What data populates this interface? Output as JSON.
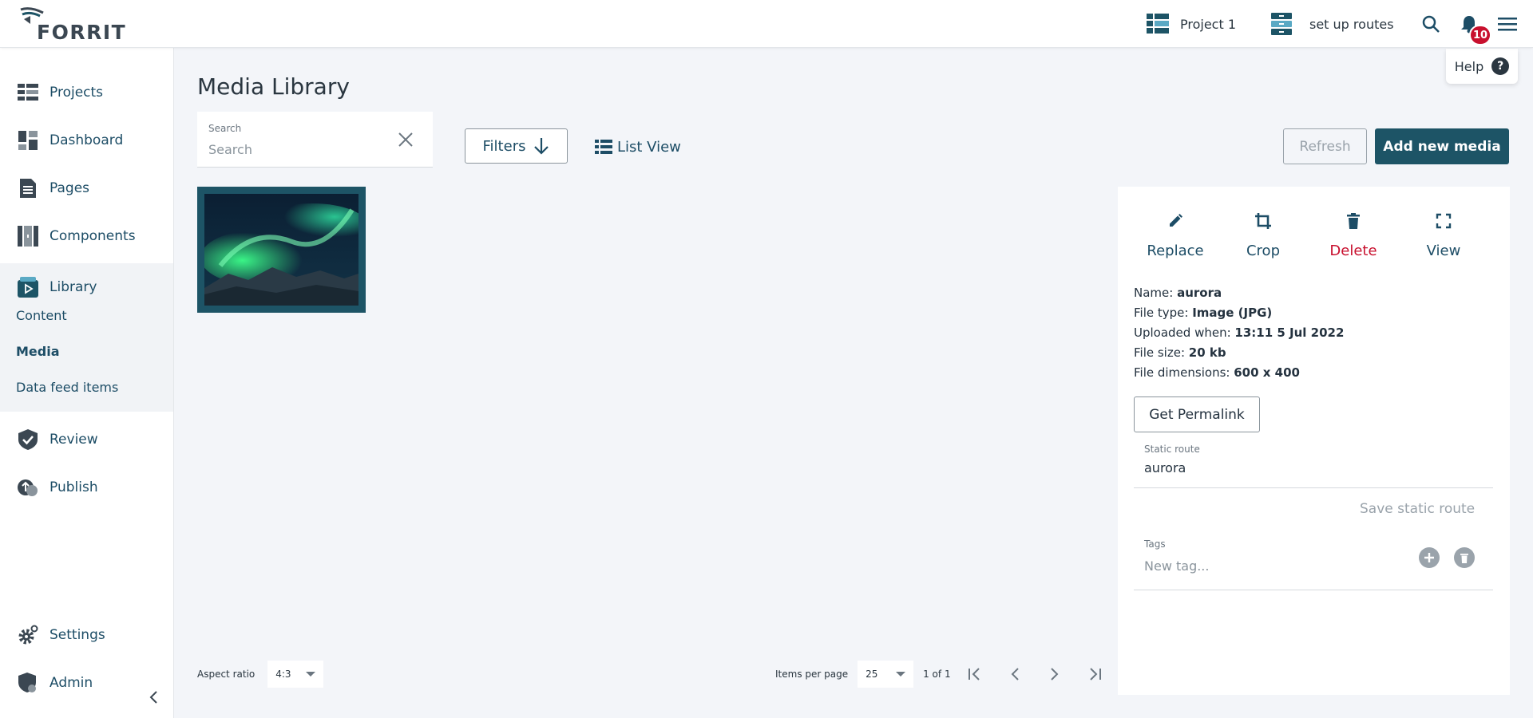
{
  "brand": {
    "logo_text": "FORRIT"
  },
  "topbar": {
    "project_label": "Project 1",
    "task_label": "set up routes",
    "notifications_count": "10",
    "help_label": "Help",
    "help_glyph": "?"
  },
  "sidebar": {
    "items": [
      {
        "label": "Projects",
        "icon": "projects-icon"
      },
      {
        "label": "Dashboard",
        "icon": "dashboard-icon"
      },
      {
        "label": "Pages",
        "icon": "pages-icon"
      },
      {
        "label": "Components",
        "icon": "components-icon"
      },
      {
        "label": "Library",
        "icon": "library-icon"
      },
      {
        "label": "Review",
        "icon": "review-icon"
      },
      {
        "label": "Publish",
        "icon": "publish-icon"
      },
      {
        "label": "Settings",
        "icon": "settings-icon"
      },
      {
        "label": "Admin",
        "icon": "admin-icon"
      }
    ],
    "library_sub": [
      "Content",
      "Media",
      "Data feed items"
    ],
    "active_sub": "Media"
  },
  "main": {
    "title": "Media Library",
    "search": {
      "label": "Search",
      "placeholder": "Search",
      "value": ""
    },
    "filters_label": "Filters",
    "list_view_label": "List View",
    "refresh_label": "Refresh",
    "add_media_label": "Add new media",
    "media": [
      {
        "name": "aurora"
      }
    ],
    "aspect_ratio": {
      "label": "Aspect ratio",
      "value": "4:3"
    },
    "pagination": {
      "items_per_page_label": "Items per page",
      "items_per_page": "25",
      "page_info": "1 of 1"
    }
  },
  "details": {
    "actions": {
      "replace": "Replace",
      "crop": "Crop",
      "delete": "Delete",
      "view": "View"
    },
    "meta": {
      "name_label": "Name:",
      "name": "aurora",
      "type_label": "File type:",
      "type": "Image (JPG)",
      "uploaded_label": "Uploaded when:",
      "uploaded": "13:11 5 Jul 2022",
      "size_label": "File size:",
      "size": "20 kb",
      "dimensions_label": "File dimensions:",
      "dimensions": "600 x 400"
    },
    "permalink_label": "Get Permalink",
    "static_route": {
      "label": "Static route",
      "value": "aurora"
    },
    "save_route_label": "Save static route",
    "tags": {
      "label": "Tags",
      "placeholder": "New tag..."
    }
  },
  "colors": {
    "primary": "#1d5466",
    "danger": "#c8102e",
    "background": "#f3f5f9",
    "nav_text": "#1d4d66"
  }
}
